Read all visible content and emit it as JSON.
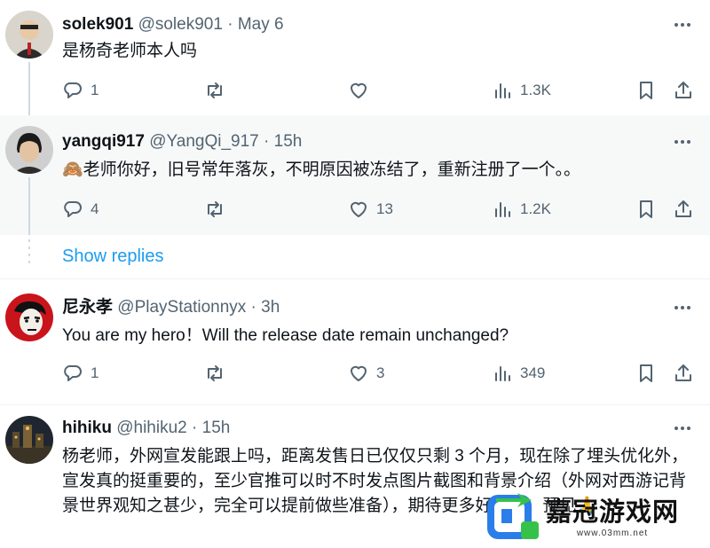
{
  "tweets": [
    {
      "name": "solek901",
      "handle": "@solek901",
      "sep": "·",
      "time": "May 6",
      "text": "是杨奇老师本人吗",
      "replies": "1",
      "retweets": "",
      "likes": "",
      "views": "1.3K"
    },
    {
      "name": "yangqi917",
      "handle": "@YangQi_917",
      "sep": "·",
      "time": "15h",
      "text": "🙈老师你好，旧号常年落灰，不明原因被冻结了，重新注册了一个。。",
      "replies": "4",
      "retweets": "",
      "likes": "13",
      "views": "1.2K"
    },
    {
      "name": "尼永孝",
      "handle": "@PlayStationnyx",
      "sep": "·",
      "time": "3h",
      "text": "You are my hero！Will the release date remain unchanged?",
      "replies": "1",
      "retweets": "",
      "likes": "3",
      "views": "349"
    },
    {
      "name": "hihiku",
      "handle": "@hihiku2",
      "sep": "·",
      "time": "15h",
      "text": "杨老师，外网宣发能跟上吗，距离发售日已仅仅只剩 3 个月，现在除了埋头优化外，宣发真的挺重要的，至少官推可以时不时发点图片截图和背景介绍（外网对西游记背景世界观知之甚少，完全可以提前做些准备），期待更多好消息。预见🙏"
    }
  ],
  "show_replies": "Show replies",
  "watermark": {
    "title": "嘉冠游戏网",
    "url": "www.03mm.net"
  },
  "icons": {
    "reply": "reply-icon",
    "retweet": "retweet-icon",
    "like": "heart-icon",
    "views": "views-icon",
    "bookmark": "bookmark-icon",
    "share": "share-icon",
    "more": "more-icon"
  },
  "colors": {
    "link": "#1d9bf0",
    "secondary_text": "#536471",
    "highlight_bg": "#f7f9f9"
  }
}
